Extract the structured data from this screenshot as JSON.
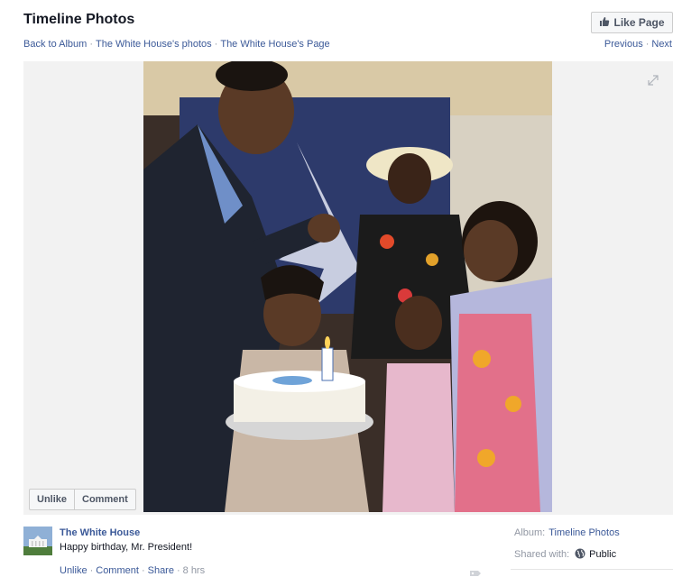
{
  "header": {
    "title": "Timeline Photos",
    "like_page_label": "Like Page",
    "like_icon": "thumbs-up-icon"
  },
  "breadcrumb": {
    "items": [
      "Back to Album",
      "The White House's photos",
      "The White House's Page"
    ],
    "separator": "·"
  },
  "pager": {
    "previous": "Previous",
    "next": "Next",
    "separator": "·"
  },
  "photo": {
    "description": "Family gathered around a birthday cake with lit candles",
    "expand_icon": "expand-icon",
    "actions": [
      "Unlike",
      "Comment"
    ]
  },
  "post": {
    "page_name": "The White House",
    "avatar_icon": "white-house-avatar",
    "caption": "Happy birthday, Mr. President!",
    "actions": [
      "Unlike",
      "Comment",
      "Share"
    ],
    "separator": "·",
    "timestamp": "8 hrs",
    "tag_icon": "tag-icon"
  },
  "meta": {
    "album_label": "Album:",
    "album_value": "Timeline Photos",
    "shared_label": "Shared with:",
    "shared_value": "Public",
    "globe_icon": "globe-icon"
  },
  "colors": {
    "link": "#3b5998",
    "text": "#141823",
    "muted": "#9197a3",
    "stage_bg": "#f2f2f2"
  }
}
